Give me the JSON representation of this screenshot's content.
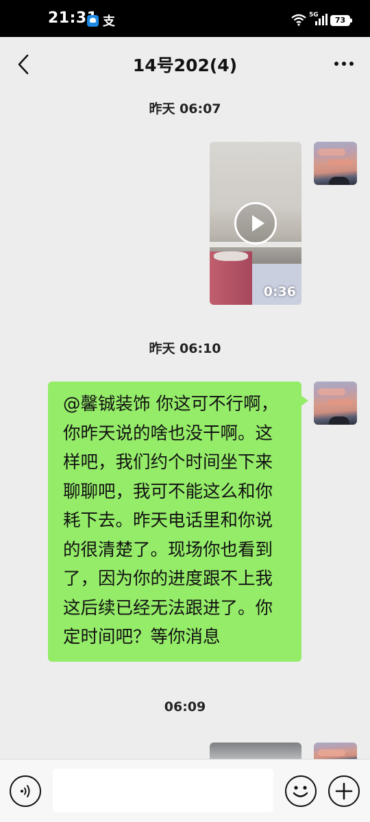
{
  "status_bar": {
    "time": "21:31",
    "app_text": "支",
    "network": "5G",
    "battery": "73"
  },
  "header": {
    "title": "14号202(4)"
  },
  "messages": [
    {
      "timestamp": "昨天 06:07",
      "video_duration": "0:36"
    },
    {
      "timestamp": "昨天 06:10",
      "text": "@馨铖装饰  你这可不行啊，你昨天说的啥也没干啊。这样吧，我们约个时间坐下来聊聊吧，我可不能这么和你耗下去。昨天电话里和你说的很清楚了。现场你也看到了，因为你的进度跟不上我这后续已经无法跟进了。你定时间吧？等你消息"
    },
    {
      "timestamp": "06:09"
    }
  ],
  "input": {
    "value": "",
    "placeholder": ""
  },
  "colors": {
    "bubble": "#95ec69",
    "background": "#ededed"
  },
  "icons": {
    "back": "back-arrow-icon",
    "more": "more-dots-icon",
    "voice": "voice-icon",
    "emoji": "emoji-icon",
    "plus": "plus-icon",
    "play": "play-icon"
  }
}
